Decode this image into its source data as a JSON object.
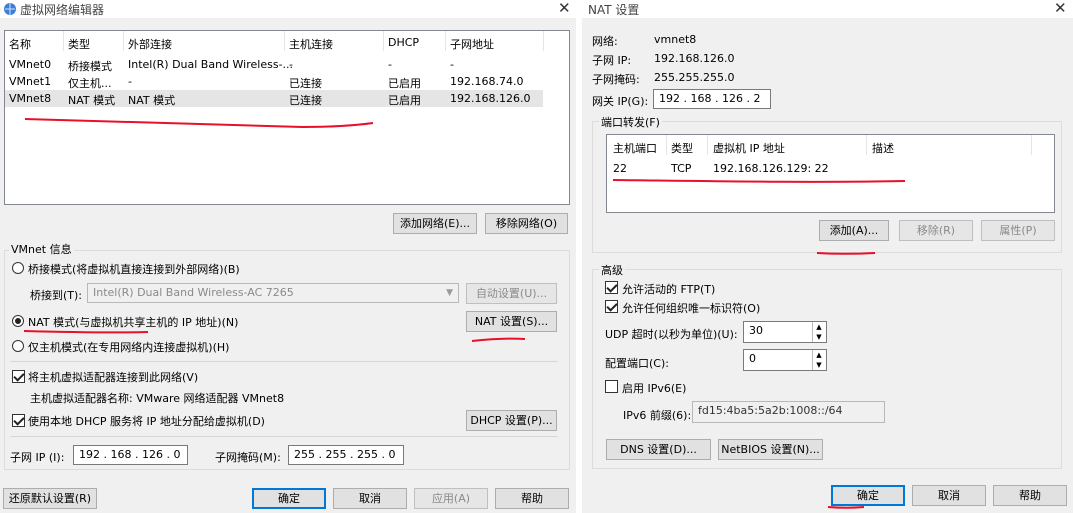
{
  "left": {
    "title": "虚拟网络编辑器",
    "columns": [
      "名称",
      "类型",
      "外部连接",
      "主机连接",
      "DHCP",
      "子网地址"
    ],
    "rows": [
      [
        "VMnet0",
        "桥接模式",
        "Intel(R) Dual Band Wireless-...",
        "-",
        "-",
        "-"
      ],
      [
        "VMnet1",
        "仅主机...",
        "-",
        "已连接",
        "已启用",
        "192.168.74.0"
      ],
      [
        "VMnet8",
        "NAT 模式",
        "NAT 模式",
        "已连接",
        "已启用",
        "192.168.126.0"
      ]
    ],
    "add_network": "添加网络(E)...",
    "remove_network": "移除网络(O)",
    "vmnet_info": "VMnet 信息",
    "radio_bridge": "桥接模式(将虚拟机直接连接到外部网络)(B)",
    "bridge_to_label": "桥接到(T):",
    "bridge_to_value": "Intel(R) Dual Band Wireless-AC 7265",
    "auto_settings": "自动设置(U)...",
    "radio_nat": "NAT 模式(与虚拟机共享主机的 IP 地址)(N)",
    "nat_settings": "NAT 设置(S)...",
    "radio_host": "仅主机模式(在专用网络内连接虚拟机)(H)",
    "cb_host_adapter": "将主机虚拟适配器连接到此网络(V)",
    "host_adapter_name": "主机虚拟适配器名称: VMware 网络适配器 VMnet8",
    "cb_dhcp": "使用本地 DHCP 服务将 IP 地址分配给虚拟机(D)",
    "dhcp_settings": "DHCP 设置(P)...",
    "subnet_ip_label": "子网 IP (I):",
    "subnet_ip": "192 . 168 . 126 . 0",
    "subnet_mask_label": "子网掩码(M):",
    "subnet_mask": "255 . 255 . 255 . 0",
    "restore": "还原默认设置(R)",
    "ok": "确定",
    "cancel": "取消",
    "apply": "应用(A)",
    "help": "帮助"
  },
  "right": {
    "title": "NAT 设置",
    "network_label": "网络:",
    "network_value": "vmnet8",
    "subnet_ip_label": "子网 IP:",
    "subnet_ip_value": "192.168.126.0",
    "subnet_mask_label": "子网掩码:",
    "subnet_mask_value": "255.255.255.0",
    "gateway_label": "网关 IP(G):",
    "gateway_value": "192 . 168 . 126 . 2",
    "port_forward_label": "端口转发(F)",
    "pf_columns": [
      "主机端口",
      "类型",
      "虚拟机 IP 地址",
      "描述"
    ],
    "pf_rows": [
      [
        "22",
        "TCP",
        "192.168.126.129: 22",
        ""
      ]
    ],
    "add": "添加(A)...",
    "remove": "移除(R)",
    "properties": "属性(P)",
    "advanced_label": "高级",
    "cb_ftp": "允许活动的 FTP(T)",
    "cb_oui": "允许任何组织唯一标识符(O)",
    "udp_timeout_label": "UDP 超时(以秒为单位)(U):",
    "udp_timeout_value": "30",
    "config_port_label": "配置端口(C):",
    "config_port_value": "0",
    "cb_ipv6": "启用 IPv6(E)",
    "ipv6_prefix_label": "IPv6 前缀(6):",
    "ipv6_prefix_value": "fd15:4ba5:5a2b:1008::/64",
    "dns_settings": "DNS 设置(D)...",
    "netbios_settings": "NetBIOS 设置(N)...",
    "ok": "确定",
    "cancel": "取消",
    "help": "帮助"
  },
  "colors": {
    "selection_row": "#e5e5e5",
    "annotation_red": "#e8102b",
    "focus_blue": "#0078d7"
  }
}
